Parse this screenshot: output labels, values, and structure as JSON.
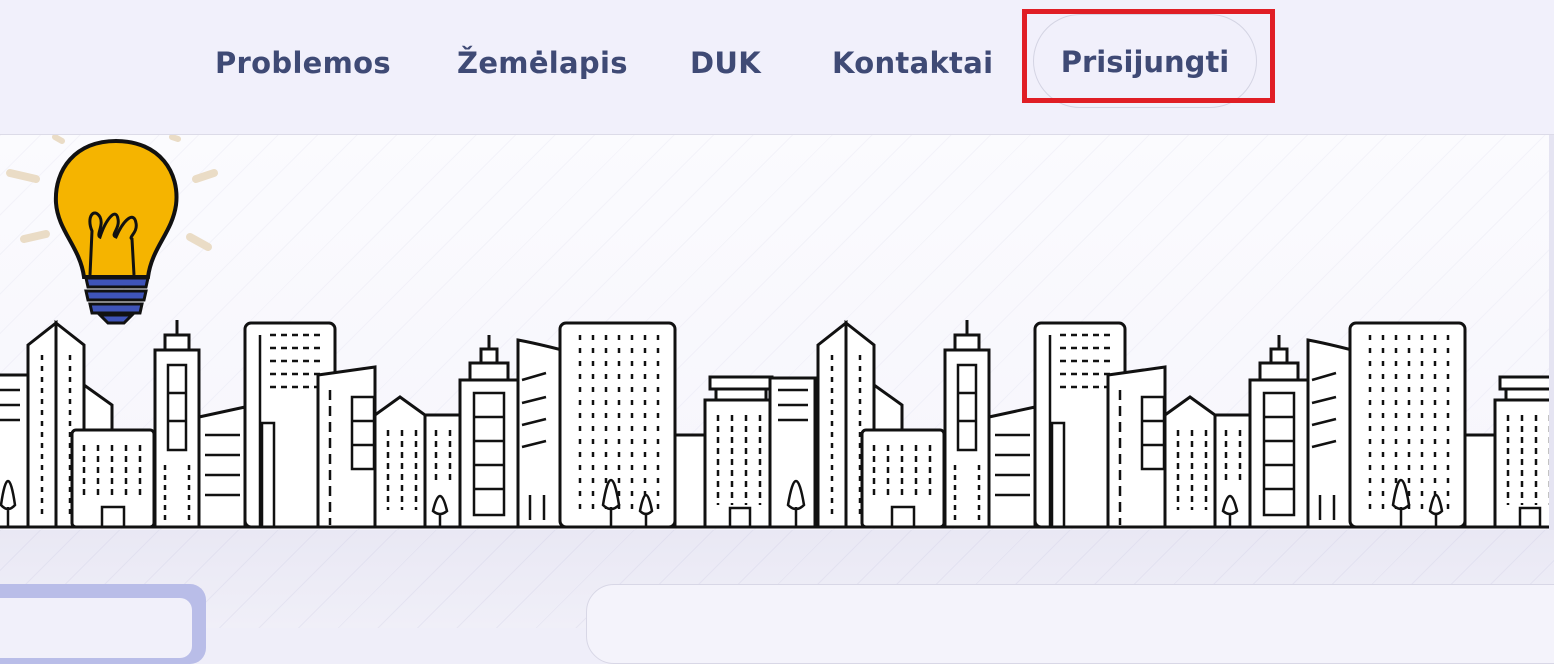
{
  "nav": {
    "items": [
      {
        "label": "Problemos"
      },
      {
        "label": "Žemėlapis"
      },
      {
        "label": "DUK"
      },
      {
        "label": "Kontaktai"
      }
    ],
    "login_label": "Prisijungti"
  },
  "hero": {
    "illustration": "city-skyline-with-lightbulb",
    "icon_names": [
      "lightbulb-icon",
      "city-skyline"
    ]
  },
  "colors": {
    "nav_text": "#3f4a75",
    "highlight": "#e01e25",
    "bulb_yellow": "#f5b400",
    "bulb_base": "#3f54b8",
    "card_accent": "#b9bde8"
  }
}
